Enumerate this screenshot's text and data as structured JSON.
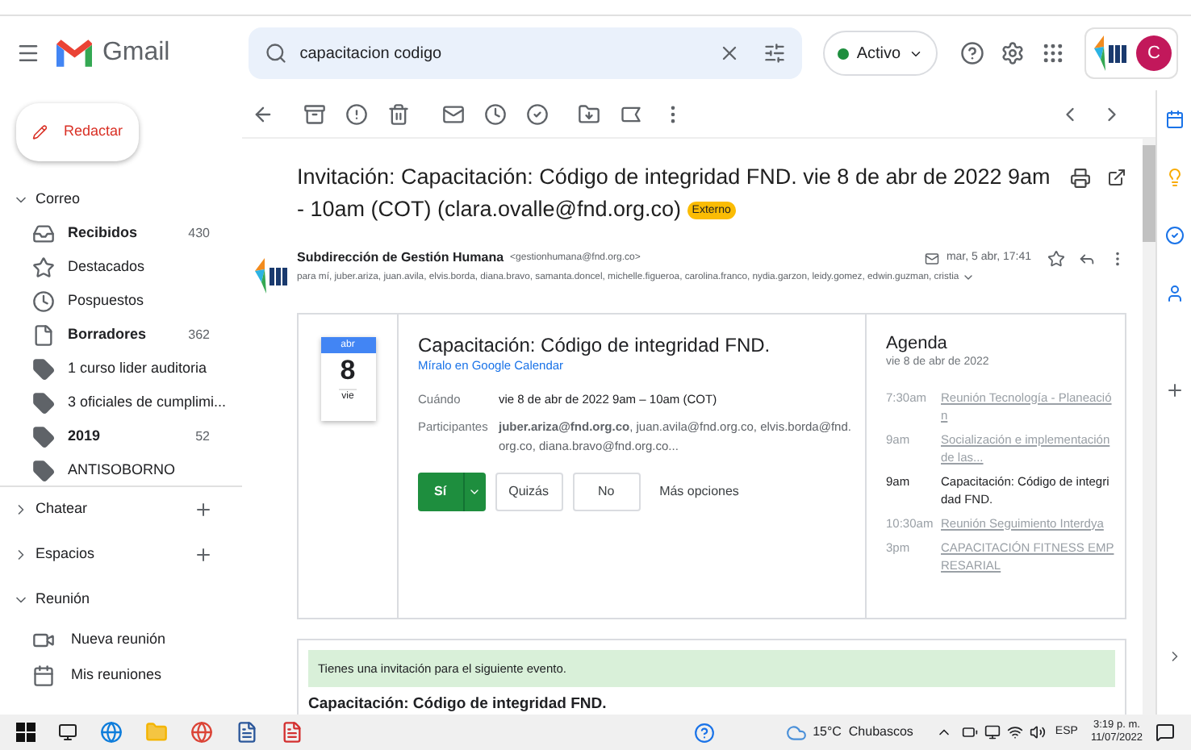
{
  "header": {
    "app_name": "Gmail",
    "search": {
      "value": "capacitacion codigo"
    },
    "status": {
      "label": "Activo",
      "on": true
    },
    "avatar_letter": "C"
  },
  "compose": {
    "label": "Redactar"
  },
  "sidebar": {
    "section": {
      "label": "Correo",
      "expanded": true
    },
    "items": [
      {
        "kind": "inbox",
        "label": "Recibidos",
        "bold": true,
        "count": "430"
      },
      {
        "kind": "star",
        "label": "Destacados",
        "bold": false
      },
      {
        "kind": "clock",
        "label": "Pospuestos",
        "bold": false
      },
      {
        "kind": "draft",
        "label": "Borradores",
        "bold": true,
        "count": "362"
      },
      {
        "kind": "label",
        "label": "1 curso lider auditoria",
        "bold": false
      },
      {
        "kind": "label",
        "label": "3 oficiales de cumplimi...",
        "bold": false
      },
      {
        "kind": "label",
        "label": "2019",
        "bold": true,
        "count": "52"
      },
      {
        "kind": "label",
        "label": "ANTISOBORNO",
        "bold": false
      }
    ],
    "groups": [
      {
        "label": "Chatear",
        "expanded": false
      },
      {
        "label": "Espacios",
        "expanded": false
      }
    ],
    "meeting": {
      "label": "Reunión",
      "expanded": true,
      "items": [
        {
          "kind": "new",
          "label": "Nueva reunión"
        },
        {
          "kind": "calendar",
          "label": "Mis reuniones"
        }
      ]
    }
  },
  "email": {
    "subject": "Invitación: Capacitación: Código de integridad FND. vie 8 de abr de 2022 9am - 10am (COT) (clara.ovalle@fnd.org.co)",
    "tag": "Externo",
    "sender_name": "Subdirección de Gestión Humana",
    "sender_address": "<gestionhumana@fnd.org.co>",
    "date": "mar, 5 abr, 17:41",
    "recipients": "para mí, juber.ariza, juan.avila, elvis.borda, diana.bravo, samanta.doncel, michelle.figueroa, carolina.franco, nydia.garzon, leidy.gomez, edwin.guzman, cristia"
  },
  "invite": {
    "month": "abr",
    "day": "8",
    "weekday": "vie",
    "title": "Capacitación: Código de integridad FND.",
    "calendar_link": "Míralo en Google Calendar",
    "when_label": "Cuándo",
    "when": "vie 8 de abr de 2022 9am – 10am (COT)",
    "guests_label": "Participantes",
    "guests": "**juber.ariza@fnd.org.co**, juan.avila@fnd.org.co, elvis.borda@fnd.org.co, diana.bravo@fnd.org.co...",
    "rsvp": [
      {
        "label": "Sí",
        "selected": true
      },
      {
        "label": "Quizás",
        "selected": false
      },
      {
        "label": "No",
        "selected": false
      }
    ],
    "more": "Más opciones"
  },
  "agenda": {
    "title": "Agenda",
    "date": "vie 8 de abr de 2022",
    "events": [
      {
        "time": "7:30am",
        "title": "Reunión Tecnología - Planeación",
        "current": false
      },
      {
        "time": "9am",
        "title": "Socialización e implementación de las...",
        "current": false
      },
      {
        "time": "9am",
        "title": "Capacitación: Código de integridad FND.",
        "current": true
      },
      {
        "time": "10:30am",
        "title": "Reunión Seguimiento Interdya",
        "current": false
      },
      {
        "time": "3pm",
        "title": "CAPACITACIÓN FITNESS EMPRESARIAL",
        "current": false
      }
    ]
  },
  "notice": "Tienes una invitación para el siguiente evento.",
  "event_title": "Capacitación: Código de integridad FND.",
  "taskbar": {
    "weather": "15°C  Chubascos",
    "language": "ESP",
    "time": "3:19 p. m.",
    "date": "11/07/2022"
  }
}
